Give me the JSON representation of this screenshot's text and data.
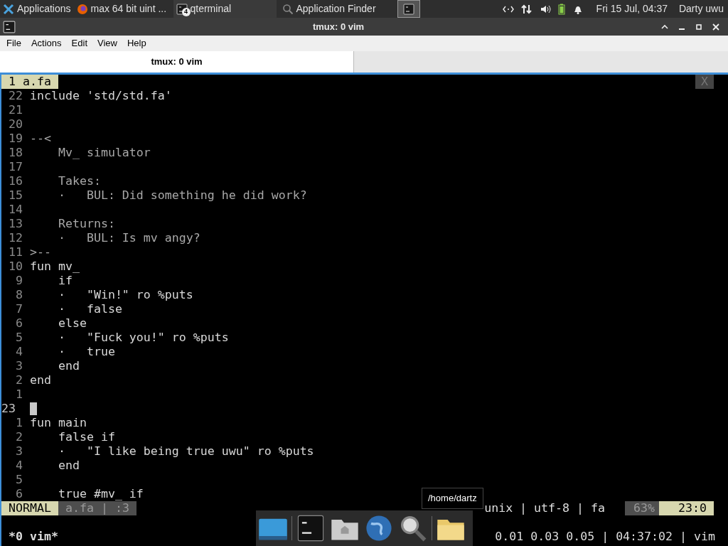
{
  "panel": {
    "items": [
      {
        "label": "Applications",
        "kind": "menu",
        "selected": false
      },
      {
        "label": "max 64 bit uint ...",
        "kind": "browser",
        "selected": false
      },
      {
        "label": "qterminal",
        "kind": "terminal",
        "badge": "4",
        "selected": false
      },
      {
        "label": "Application Finder",
        "kind": "finder",
        "selected": false
      },
      {
        "kind": "terminal-only",
        "selected": true
      }
    ],
    "clock": "Fri 15 Jul, 04:37",
    "user": "Darty uwu"
  },
  "window": {
    "title": "tmux: 0 vim"
  },
  "menu": [
    "File",
    "Actions",
    "Edit",
    "View",
    "Help"
  ],
  "tabs": [
    {
      "label": "tmux: 0 vim",
      "selected": true
    }
  ],
  "vim": {
    "tabline": [
      {
        "label": "1 a.fa",
        "selected": true
      }
    ],
    "close": "X",
    "lines": [
      {
        "number": "22",
        "text": "include 'std/std.fa'",
        "kind": "code"
      },
      {
        "number": "21",
        "kind": "code"
      },
      {
        "number": "20",
        "kind": "code"
      },
      {
        "number": "19",
        "text": "--<",
        "kind": "comment"
      },
      {
        "number": "18",
        "text": "    Mv_ simulator",
        "kind": "comment"
      },
      {
        "number": "17",
        "kind": "comment"
      },
      {
        "number": "16",
        "text": "    Takes:",
        "kind": "comment"
      },
      {
        "number": "15",
        "text": "    ·   BUL: Did something he did work?",
        "kind": "comment"
      },
      {
        "number": "14",
        "kind": "comment"
      },
      {
        "number": "13",
        "text": "    Returns:",
        "kind": "comment"
      },
      {
        "number": "12",
        "text": "    ·   BUL: Is mv angy?",
        "kind": "comment"
      },
      {
        "number": "11",
        "text": ">--",
        "kind": "comment"
      },
      {
        "number": "10",
        "text": "fun mv_",
        "kind": "code"
      },
      {
        "number": "9",
        "text": "    if",
        "kind": "code"
      },
      {
        "number": "8",
        "text": "    ·   \"Win!\" ro %puts",
        "kind": "code"
      },
      {
        "number": "7",
        "text": "    ·   false",
        "kind": "code"
      },
      {
        "number": "6",
        "text": "    else",
        "kind": "code"
      },
      {
        "number": "5",
        "text": "    ·   \"Fuck you!\" ro %puts",
        "kind": "code"
      },
      {
        "number": "4",
        "text": "    ·   true",
        "kind": "code"
      },
      {
        "number": "3",
        "text": "    end",
        "kind": "code"
      },
      {
        "number": "2",
        "text": "end",
        "kind": "code"
      },
      {
        "number": "1",
        "kind": "code"
      },
      {
        "number": "23",
        "kind": "cursor"
      },
      {
        "number": "1",
        "text": "fun main",
        "kind": "code"
      },
      {
        "number": "2",
        "text": "    false if",
        "kind": "code"
      },
      {
        "number": "3",
        "text": "    ·   \"I like being true uwu\" ro %puts",
        "kind": "code"
      },
      {
        "number": "4",
        "text": "    end",
        "kind": "code"
      },
      {
        "number": "5",
        "kind": "code"
      },
      {
        "number": "6",
        "text": "    true #mv_ if",
        "kind": "code"
      }
    ],
    "status": {
      "mode": "NORMAL",
      "file": "a.fa | :3",
      "info": "unix | utf-8 | fa",
      "percent": "63%",
      "position": "23:0"
    }
  },
  "tmux": {
    "window": "*0 vim*",
    "right": "0.01 0.03 0.05 | 04:37:02 | vim"
  },
  "dock": {
    "tooltip": "/home/dartz"
  }
}
